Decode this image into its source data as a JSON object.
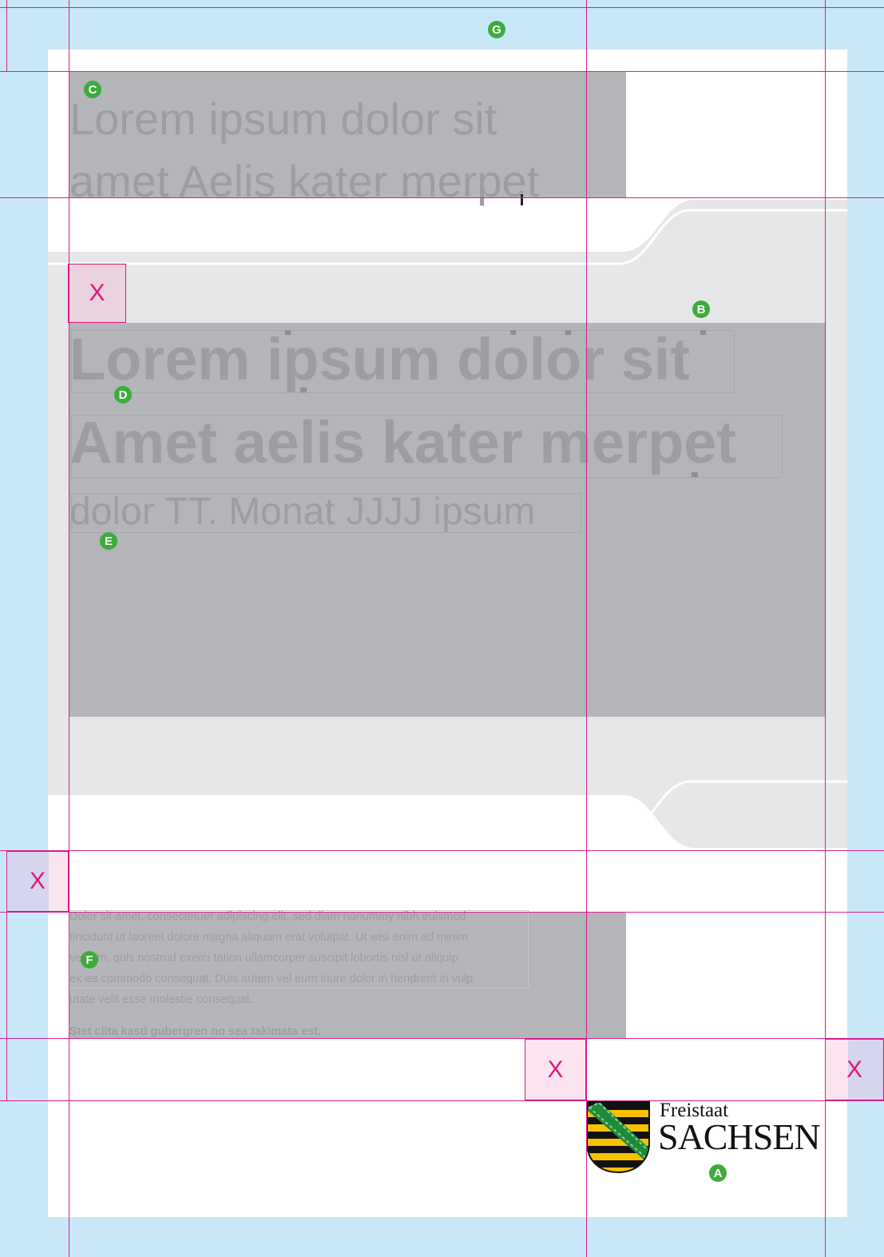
{
  "header_headline": {
    "line1": "Lorem ipsum dolor sit",
    "line2": "amet Aelis kater merpet"
  },
  "title": {
    "line1": "Lorem ipsum dolor sit",
    "line2": "Amet aelis kater merpet",
    "subline": "dolor TT. Monat JJJJ ipsum"
  },
  "body_text": {
    "paragraph": [
      "Dolor sit amet, consectetuer adipiscing elit, sed diam nonummy nibh euismod",
      "tincidunt ut laoreet dolore magna aliquam erat volutpat. Ut wisi enim ad minim",
      "veniam, quis nostrud exerci tation ullamcorper suscipit lobortis nisl ut aliquip",
      "ex ea commodo consequat. Duis autem vel eum iriure dolor in hendrerit in vulp",
      "utate velit esse molestie consequat."
    ],
    "closing": "Stet clita kasd gubergren no sea takimata est."
  },
  "markers": {
    "a": "A",
    "b": "B",
    "c": "C",
    "d": "D",
    "e": "E",
    "f": "F",
    "g": "G"
  },
  "spacing_mark": "X",
  "logo": {
    "line1": "Freistaat",
    "line2": "SACHSEN"
  },
  "colors": {
    "margin_blue": "#c8e8f7",
    "guide_magenta": "#d6218e",
    "marker_green": "#3dac3a",
    "placeholder_gray": "#b4b5b8",
    "band_gray": "#e6e7e8",
    "coat_yellow": "#f7c200",
    "coat_green": "#1f8a3a"
  }
}
